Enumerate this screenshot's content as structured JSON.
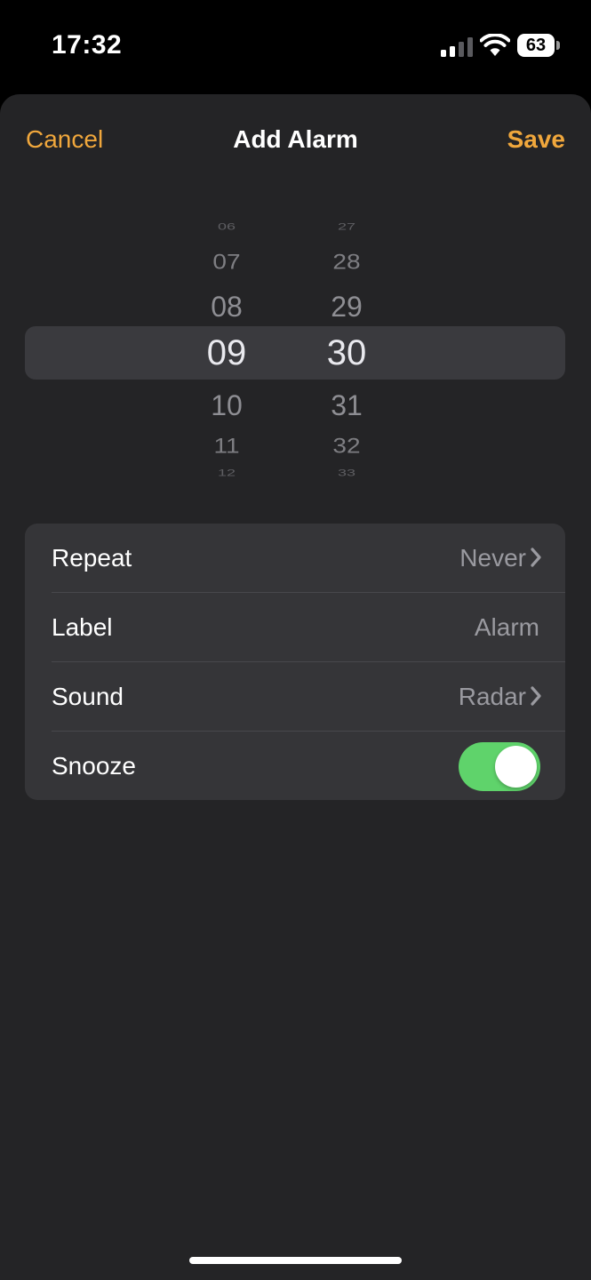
{
  "status_bar": {
    "time": "17:32",
    "battery_level": "63",
    "signal_icon": "cellular-signal-icon",
    "wifi_icon": "wifi-icon",
    "battery_icon": "battery-icon"
  },
  "nav": {
    "cancel_label": "Cancel",
    "title": "Add Alarm",
    "save_label": "Save",
    "accent_color": "#f0a73c"
  },
  "picker": {
    "hours": [
      "06",
      "07",
      "08",
      "09",
      "10",
      "11",
      "12"
    ],
    "minutes": [
      "27",
      "28",
      "29",
      "30",
      "31",
      "32",
      "33"
    ],
    "selected_hour": "09",
    "selected_minute": "30"
  },
  "settings": {
    "repeat": {
      "label": "Repeat",
      "value": "Never"
    },
    "label": {
      "label": "Label",
      "value": "Alarm"
    },
    "sound": {
      "label": "Sound",
      "value": "Radar"
    },
    "snooze": {
      "label": "Snooze",
      "enabled": true,
      "toggle_color": "#5fd36b"
    }
  }
}
